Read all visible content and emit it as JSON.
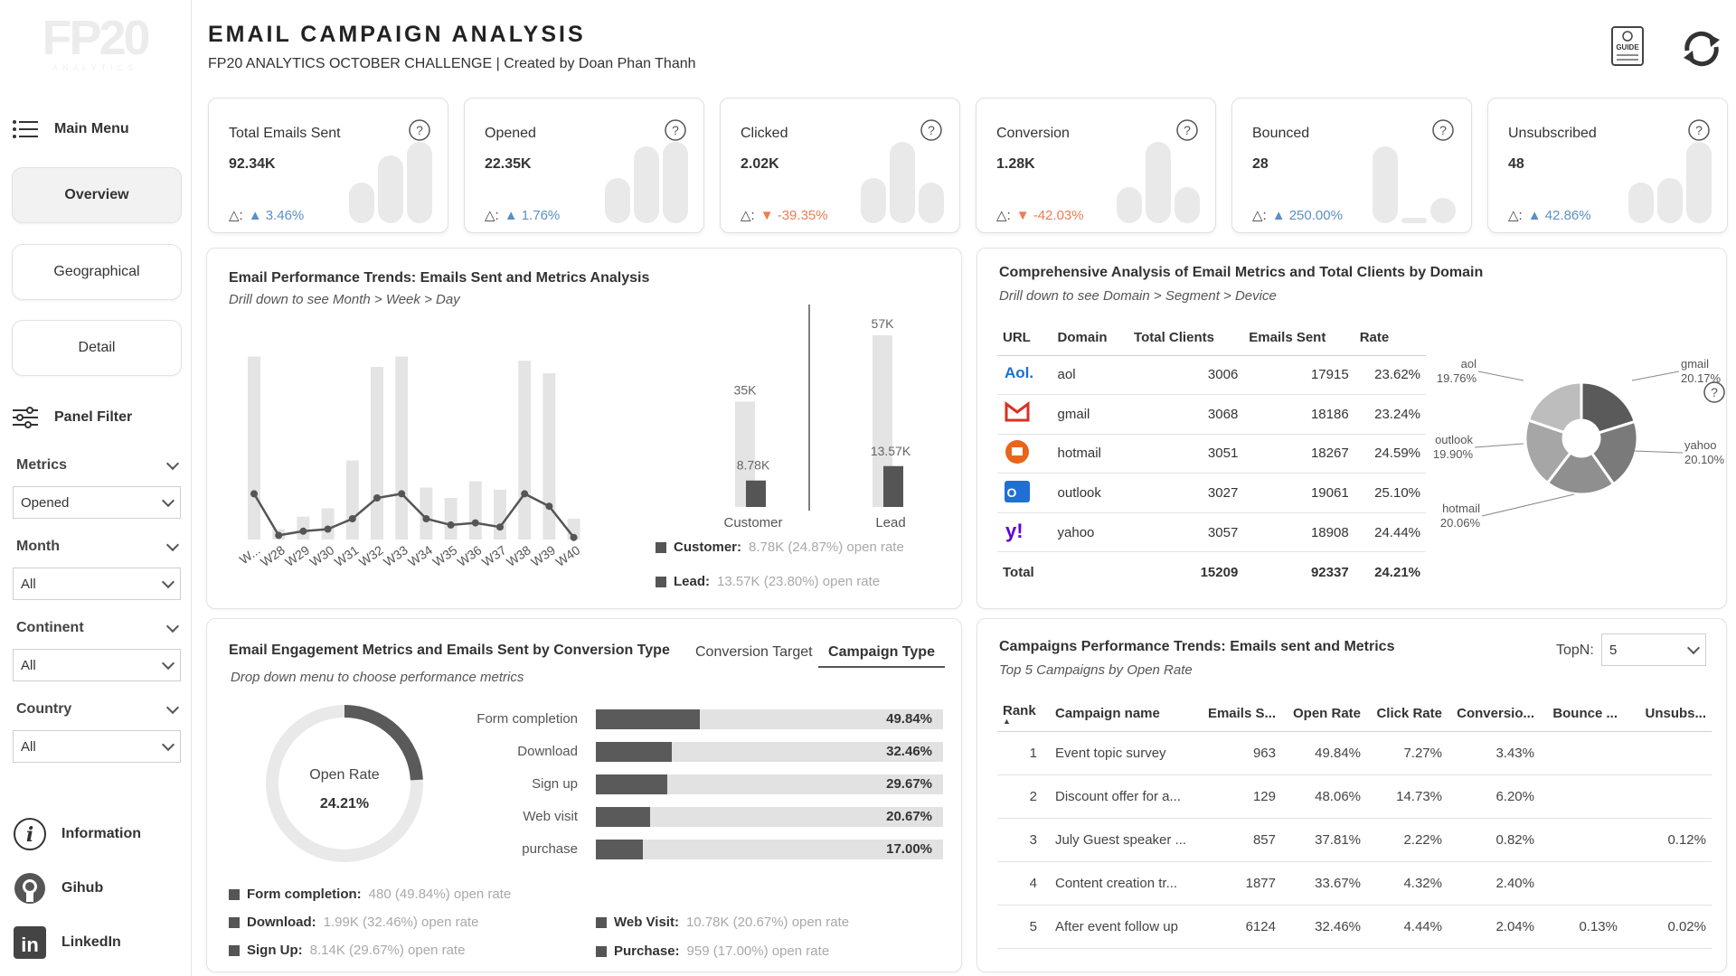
{
  "logo": {
    "text": "FP20",
    "sub": "ANALYTICS"
  },
  "header": {
    "title": "EMAIL CAMPAIGN ANALYSIS",
    "subtitle": "FP20 ANALYTICS OCTOBER CHALLENGE | Created by Doan Phan Thanh",
    "guide_icon": "guide-book-icon",
    "refresh_icon": "refresh-icon"
  },
  "sidebar": {
    "main_menu": "Main Menu",
    "nav": [
      "Overview",
      "Geographical",
      "Detail"
    ],
    "panel_filter": "Panel Filter",
    "filters": [
      {
        "label": "Metrics",
        "value": "Opened"
      },
      {
        "label": "Month",
        "value": "All"
      },
      {
        "label": "Continent",
        "value": "All"
      },
      {
        "label": "Country",
        "value": "All"
      }
    ],
    "links": [
      "Information",
      "Gihub",
      "LinkedIn"
    ]
  },
  "kpis": [
    {
      "label": "Total Emails Sent",
      "value": "92.34K",
      "delta_prefix": "△:",
      "delta": "▲ 3.46%",
      "dir": "up",
      "bars": [
        0.45,
        0.75,
        0.9
      ]
    },
    {
      "label": "Opened",
      "value": "22.35K",
      "delta_prefix": "△:",
      "delta": "▲ 1.76%",
      "dir": "up",
      "bars": [
        0.5,
        0.85,
        0.9
      ]
    },
    {
      "label": "Clicked",
      "value": "2.02K",
      "delta_prefix": "△:",
      "delta": "▼ -39.35%",
      "dir": "down",
      "bars": [
        0.5,
        0.9,
        0.45
      ]
    },
    {
      "label": "Conversion",
      "value": "1.28K",
      "delta_prefix": "△:",
      "delta": "▼ -42.03%",
      "dir": "down",
      "bars": [
        0.4,
        0.9,
        0.4
      ]
    },
    {
      "label": "Bounced",
      "value": "28",
      "delta_prefix": "△:",
      "delta": "▲ 250.00%",
      "dir": "up",
      "bars": [
        0.85,
        0.06,
        0.28
      ]
    },
    {
      "label": "Unsubscribed",
      "value": "48",
      "delta_prefix": "△:",
      "delta": "▲ 42.86%",
      "dir": "up",
      "bars": [
        0.45,
        0.5,
        0.9
      ]
    }
  ],
  "trends": {
    "title": "Email Performance Trends: Emails Sent and Metrics Analysis",
    "subtitle": "Drill down to see Month > Week > Day",
    "weeks": [
      "W...",
      "W28",
      "W29",
      "W30",
      "W31",
      "W32",
      "W33",
      "W34",
      "W35",
      "W36",
      "W37",
      "W38",
      "W39",
      "W40"
    ],
    "sent_rel": [
      0.88,
      0.05,
      0.11,
      0.15,
      0.38,
      0.83,
      0.88,
      0.25,
      0.2,
      0.28,
      0.24,
      0.86,
      0.8,
      0.1
    ],
    "metric_rel": [
      0.22,
      0.02,
      0.04,
      0.05,
      0.1,
      0.2,
      0.22,
      0.1,
      0.07,
      0.08,
      0.06,
      0.22,
      0.16,
      0.01
    ],
    "segments": [
      {
        "name": "Customer",
        "sent": "35K",
        "opened": "8.78K"
      },
      {
        "name": "Lead",
        "sent": "57K",
        "opened": "13.57K"
      }
    ],
    "legend": [
      {
        "name": "Customer:",
        "detail": "8.78K (24.87%) open rate"
      },
      {
        "name": "Lead:",
        "detail": "13.57K (23.80%) open rate"
      }
    ]
  },
  "domains": {
    "title": "Comprehensive Analysis of Email Metrics and Total Clients by Domain",
    "subtitle": "Drill down to see Domain > Segment > Device",
    "columns": [
      "URL",
      "Domain",
      "Total Clients",
      "Emails Sent",
      "Rate"
    ],
    "rows": [
      {
        "icon": "aol-logo-icon",
        "domain": "aol",
        "clients": "3006",
        "sent": "17915",
        "rate": "23.62%"
      },
      {
        "icon": "gmail-logo-icon",
        "domain": "gmail",
        "clients": "3068",
        "sent": "18186",
        "rate": "23.24%"
      },
      {
        "icon": "hotmail-logo-icon",
        "domain": "hotmail",
        "clients": "3051",
        "sent": "18267",
        "rate": "24.59%"
      },
      {
        "icon": "outlook-logo-icon",
        "domain": "outlook",
        "clients": "3027",
        "sent": "19061",
        "rate": "25.10%"
      },
      {
        "icon": "yahoo-logo-icon",
        "domain": "yahoo",
        "clients": "3057",
        "sent": "18908",
        "rate": "24.44%"
      }
    ],
    "total": {
      "label": "Total",
      "clients": "15209",
      "sent": "92337",
      "rate": "24.21%"
    },
    "donut": [
      {
        "name": "aol",
        "pct": "19.76%",
        "value": 19.76,
        "color": "#bdbdbd"
      },
      {
        "name": "gmail",
        "pct": "20.17%",
        "value": 20.17,
        "color": "#5a5a5a"
      },
      {
        "name": "yahoo",
        "pct": "20.10%",
        "value": 20.1,
        "color": "#7a7a7a"
      },
      {
        "name": "hotmail",
        "pct": "20.06%",
        "value": 20.06,
        "color": "#8f8f8f"
      },
      {
        "name": "outlook",
        "pct": "19.90%",
        "value": 19.9,
        "color": "#a6a6a6"
      }
    ]
  },
  "engagement": {
    "title": "Email Engagement Metrics and Emails Sent by Conversion Type",
    "subtitle": "Drop down menu to choose performance metrics",
    "tabs": [
      "Conversion Target",
      "Campaign Type"
    ],
    "gauge_label": "Open Rate",
    "gauge_value": "24.21%",
    "gauge_fraction": 0.2421,
    "bars": [
      {
        "label": "Form completion",
        "pct": "49.84%",
        "fill": 0.3
      },
      {
        "label": "Download",
        "pct": "32.46%",
        "fill": 0.22
      },
      {
        "label": "Sign up",
        "pct": "29.67%",
        "fill": 0.205
      },
      {
        "label": "Web visit",
        "pct": "20.67%",
        "fill": 0.155
      },
      {
        "label": "purchase",
        "pct": "17.00%",
        "fill": 0.135
      }
    ],
    "legend": [
      {
        "name": "Form completion:",
        "detail": "480 (49.84%) open rate"
      },
      {
        "name": "Download:",
        "detail": "1.99K (32.46%) open rate"
      },
      {
        "name": "Sign Up:",
        "detail": "8.14K (29.67%) open rate"
      },
      {
        "name": "Web Visit:",
        "detail": "10.78K (20.67%) open rate"
      },
      {
        "name": "Purchase:",
        "detail": "959 (17.00%) open rate"
      }
    ]
  },
  "campaigns": {
    "title": "Campaigns Performance Trends: Emails sent and Metrics",
    "subtitle": "Top 5 Campaigns by Open Rate",
    "topn_label": "TopN:",
    "topn_value": "5",
    "columns": [
      "Rank",
      "Campaign name",
      "Emails S...",
      "Open Rate",
      "Click Rate",
      "Conversio...",
      "Bounce ...",
      "Unsubs..."
    ],
    "rows": [
      {
        "rank": "1",
        "name": "Event topic survey",
        "sent": "963",
        "open": "49.84%",
        "click": "7.27%",
        "conv": "3.43%",
        "bounce": "",
        "unsub": ""
      },
      {
        "rank": "2",
        "name": "Discount offer for a...",
        "sent": "129",
        "open": "48.06%",
        "click": "14.73%",
        "conv": "6.20%",
        "bounce": "",
        "unsub": ""
      },
      {
        "rank": "3",
        "name": "July Guest speaker ...",
        "sent": "857",
        "open": "37.81%",
        "click": "2.22%",
        "conv": "0.82%",
        "bounce": "",
        "unsub": "0.12%"
      },
      {
        "rank": "4",
        "name": "Content creation tr...",
        "sent": "1877",
        "open": "33.67%",
        "click": "4.32%",
        "conv": "2.40%",
        "bounce": "",
        "unsub": ""
      },
      {
        "rank": "5",
        "name": "After event follow up",
        "sent": "6124",
        "open": "32.46%",
        "click": "4.44%",
        "conv": "2.04%",
        "bounce": "0.13%",
        "unsub": "0.02%"
      }
    ]
  }
}
